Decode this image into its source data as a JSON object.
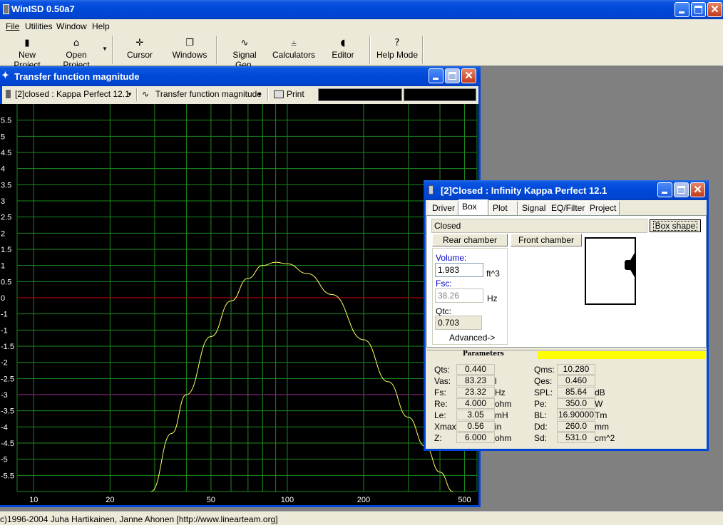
{
  "app": {
    "title": "WinISD 0.50a7",
    "menu": [
      "File",
      "Utilities",
      "Window",
      "Help"
    ],
    "toolbar": [
      "New Project",
      "Open Project",
      "Cursor",
      "Windows",
      "Signal Gen.",
      "Calculators",
      "Editor",
      "Help Mode"
    ],
    "status": "(c)1996-2004 Juha Hartikainen, Janne Ahonen [http://www.linearteam.org]"
  },
  "plot_window": {
    "title": "Transfer function magnitude",
    "project_select": "[2]closed : Kappa Perfect 12.1",
    "plot_select": "Transfer function magnitude",
    "print_label": "Print"
  },
  "chart_data": {
    "type": "line",
    "x_scale": "log",
    "xlim": [
      8.6,
      560
    ],
    "ylim": [
      -6,
      6
    ],
    "x_ticks": [
      10,
      20,
      50,
      100,
      200,
      500
    ],
    "y_ticks": [
      5.5,
      5,
      4.5,
      4,
      3.5,
      3,
      2.5,
      2,
      1.5,
      1,
      0.5,
      0,
      -0.5,
      -1,
      -1.5,
      -2,
      -2.5,
      -3,
      -3.5,
      -4,
      -4.5,
      -5,
      -5.5
    ],
    "y_tick_labels": [
      "5.5",
      "5",
      "4.5",
      "4",
      "3.5",
      "3",
      "2.5",
      "2",
      "1.5",
      "1",
      "0.5",
      "0",
      "-1",
      "-1",
      "-1.5",
      "-2",
      "-2.5",
      "-3",
      "-3.5",
      "-4",
      "-4.5",
      "-5",
      "-5.5"
    ],
    "grid": true,
    "reference_lines": [
      {
        "y": 0,
        "color": "#c80000"
      },
      {
        "y": -3,
        "color": "#9a2b8a"
      }
    ],
    "series": [
      {
        "color": "#ffff66",
        "x": [
          29,
          35,
          40,
          50,
          60,
          70,
          80,
          90,
          100,
          120,
          150,
          200,
          250,
          300,
          350,
          400,
          450
        ],
        "y": [
          -6.0,
          -4.2,
          -3.0,
          -1.2,
          -0.1,
          0.6,
          1.0,
          1.1,
          1.05,
          0.75,
          0.1,
          -1.3,
          -2.6,
          -3.7,
          -4.6,
          -5.4,
          -6.1
        ]
      }
    ],
    "colors": {
      "background": "#000000",
      "grid": "#1d8a1d"
    }
  },
  "box_window": {
    "title": "[2]Closed : Infinity Kappa Perfect 12.1",
    "tabs": [
      "Driver",
      "Box",
      "Plot",
      "Signal",
      "EQ/Filter",
      "Project"
    ],
    "active_tab": "Box",
    "box_type": "Closed",
    "box_shape_button": "Box shape",
    "rear_chamber": "Rear chamber",
    "front_chamber": "Front chamber",
    "volume": {
      "label": "Volume:",
      "value": "1.983",
      "unit": "ft^3"
    },
    "fsc": {
      "label": "Fsc:",
      "value": "38.26",
      "unit": "Hz"
    },
    "qtc": {
      "label": "Qtc:",
      "value": "0.703"
    },
    "advanced": "Advanced->",
    "parameters_title": "Parameters",
    "params_left": [
      {
        "label": "Qts:",
        "value": "0.440",
        "unit": ""
      },
      {
        "label": "Vas:",
        "value": "83.23",
        "unit": "l"
      },
      {
        "label": "Fs:",
        "value": "23.32",
        "unit": "Hz"
      },
      {
        "label": "Re:",
        "value": "4.000",
        "unit": "ohm"
      },
      {
        "label": "Le:",
        "value": "3.05",
        "unit": "mH"
      },
      {
        "label": "Xmax:",
        "value": "0.56",
        "unit": "in"
      },
      {
        "label": "Z:",
        "value": "6.000",
        "unit": "ohm"
      }
    ],
    "params_right": [
      {
        "label": "Qms:",
        "value": "10.280",
        "unit": ""
      },
      {
        "label": "Qes:",
        "value": "0.460",
        "unit": ""
      },
      {
        "label": "SPL:",
        "value": "85.64",
        "unit": "dB"
      },
      {
        "label": "Pe:",
        "value": "350.0",
        "unit": "W"
      },
      {
        "label": "BL:",
        "value": "16.90000",
        "unit": "Tm"
      },
      {
        "label": "Dd:",
        "value": "260.0",
        "unit": "mm"
      },
      {
        "label": "Sd:",
        "value": "531.0",
        "unit": "cm^2"
      }
    ]
  }
}
